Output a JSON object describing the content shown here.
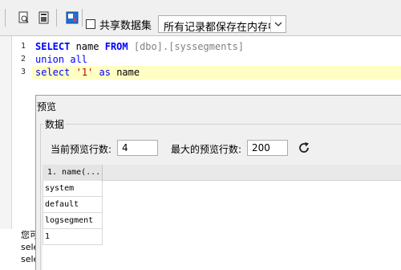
{
  "toolbar": {
    "share_dataset_label": "共享数据集",
    "share_dataset_checked": false,
    "memory_mode_value": "所有记录都保存在内存中"
  },
  "editor": {
    "lines": [
      {
        "no": "1",
        "tokens": [
          "SELECT",
          " name ",
          "FROM",
          " ",
          "[dbo].[syssegments]"
        ]
      },
      {
        "no": "2",
        "tokens": [
          "union all"
        ]
      },
      {
        "no": "3",
        "tokens": [
          "select",
          " ",
          "'1'",
          " ",
          "as",
          " name"
        ]
      }
    ]
  },
  "messages": {
    "line1": "您可",
    "line2": "sele",
    "line3": "sele"
  },
  "preview": {
    "title": "预览",
    "group_label": "数据",
    "current_rows_label": "当前预览行数:",
    "current_rows_value": "4",
    "max_rows_label": "最大的预览行数:",
    "max_rows_value": "200",
    "grid": {
      "column_header": "1. name(...",
      "rows": [
        "system",
        "default",
        "logsegment",
        "1"
      ]
    }
  },
  "icons": {
    "find": "find-icon",
    "grid": "grid-icon",
    "preview": "preview-icon",
    "refresh": "refresh-icon",
    "dropdown": "chevron-down-icon"
  }
}
